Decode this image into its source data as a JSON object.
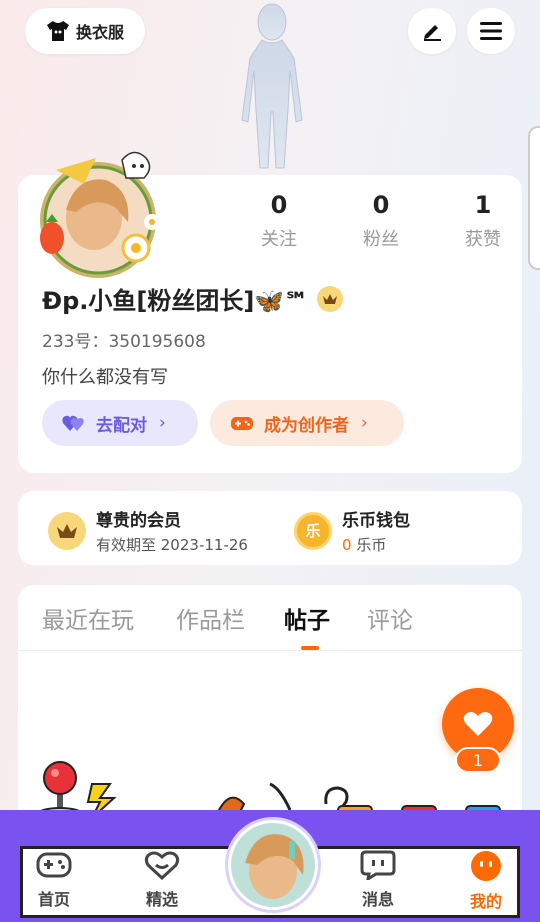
{
  "header": {
    "outfit_label": "换衣服"
  },
  "profile": {
    "stats": [
      {
        "value": "0",
        "label": "关注"
      },
      {
        "value": "0",
        "label": "粉丝"
      },
      {
        "value": "1",
        "label": "获赞"
      }
    ],
    "username": "Ɖp.小鱼[粉丝团长]🦋℠",
    "uid": "233号：350195608",
    "bio": "你什么都没有写",
    "pair_label": "去配对",
    "creator_label": "成为创作者",
    "chevron": "›"
  },
  "membership": {
    "vip_title": "尊贵的会员",
    "vip_sub": "有效期至 2023-11-26",
    "wallet_title": "乐币钱包",
    "wallet_amount": "0",
    "wallet_unit": "乐币",
    "coin_glyph": "乐"
  },
  "tabs": [
    {
      "label": "最近在玩",
      "active": false
    },
    {
      "label": "作品栏",
      "active": false
    },
    {
      "label": "帖子",
      "active": true
    },
    {
      "label": "评论",
      "active": false
    }
  ],
  "like": {
    "count": "1"
  },
  "nav": [
    {
      "label": "首页",
      "icon": "gamepad-icon",
      "active": false
    },
    {
      "label": "精选",
      "icon": "heart-outline-icon",
      "active": false
    },
    {
      "label": "",
      "icon": "avatar",
      "active": false
    },
    {
      "label": "消息",
      "icon": "chat-icon",
      "active": false
    },
    {
      "label": "我的",
      "icon": "face-icon",
      "active": true
    }
  ],
  "colors": {
    "accent": "#ff6a00",
    "nav_purple": "#7a52f0",
    "pair_purple": "#6a5be2",
    "creator_orange": "#f0641e"
  }
}
